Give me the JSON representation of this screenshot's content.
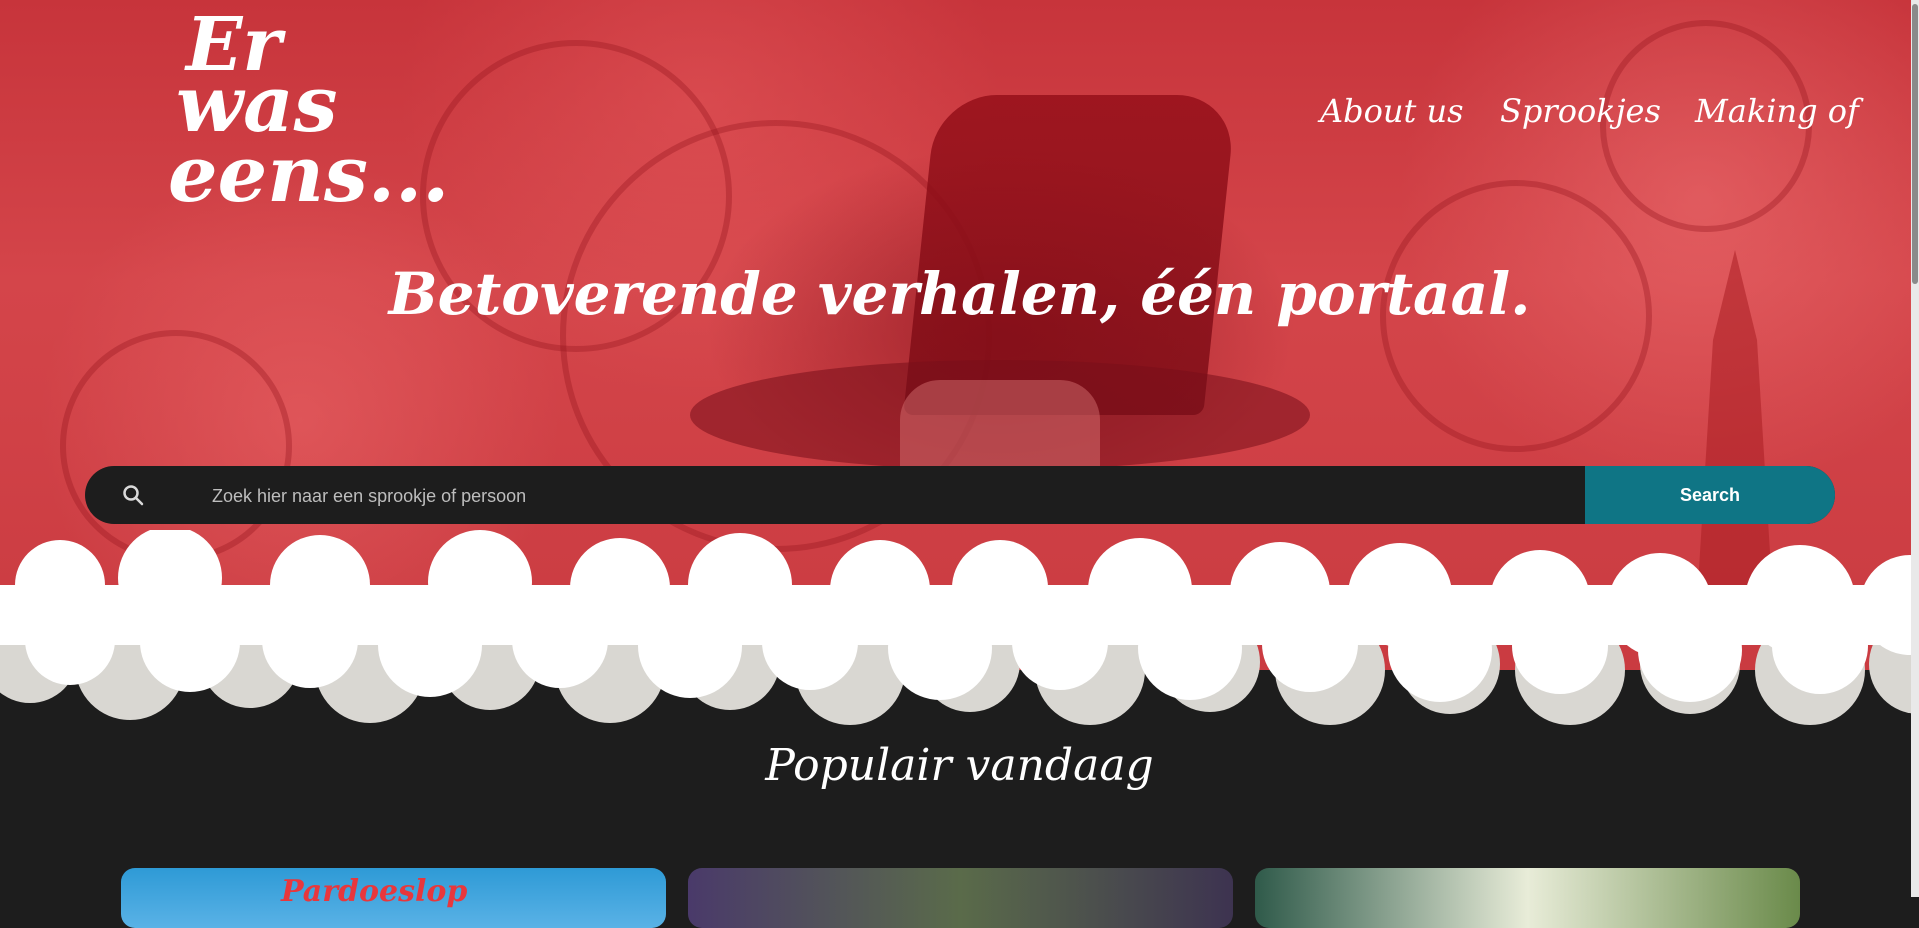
{
  "logo": {
    "line1": "Er",
    "line2": "was",
    "line3": "eens..."
  },
  "nav": {
    "items": [
      {
        "label": "About us"
      },
      {
        "label": "Sprookjes"
      },
      {
        "label": "Making of"
      }
    ]
  },
  "hero": {
    "tagline": "Betoverende verhalen, één portaal."
  },
  "search": {
    "placeholder": "Zoek hier naar een sprookje of persoon",
    "value": "",
    "button_label": "Search",
    "icon": "search-icon"
  },
  "popular": {
    "title": "Populair vandaag",
    "cards": [
      {
        "label": "Pardoeslop"
      },
      {
        "label": ""
      },
      {
        "label": ""
      }
    ]
  },
  "colors": {
    "hero_red": "#c93a40",
    "dark_bg": "#1d1d1d",
    "accent_teal": "#0f7585",
    "text_white": "#ffffff"
  }
}
